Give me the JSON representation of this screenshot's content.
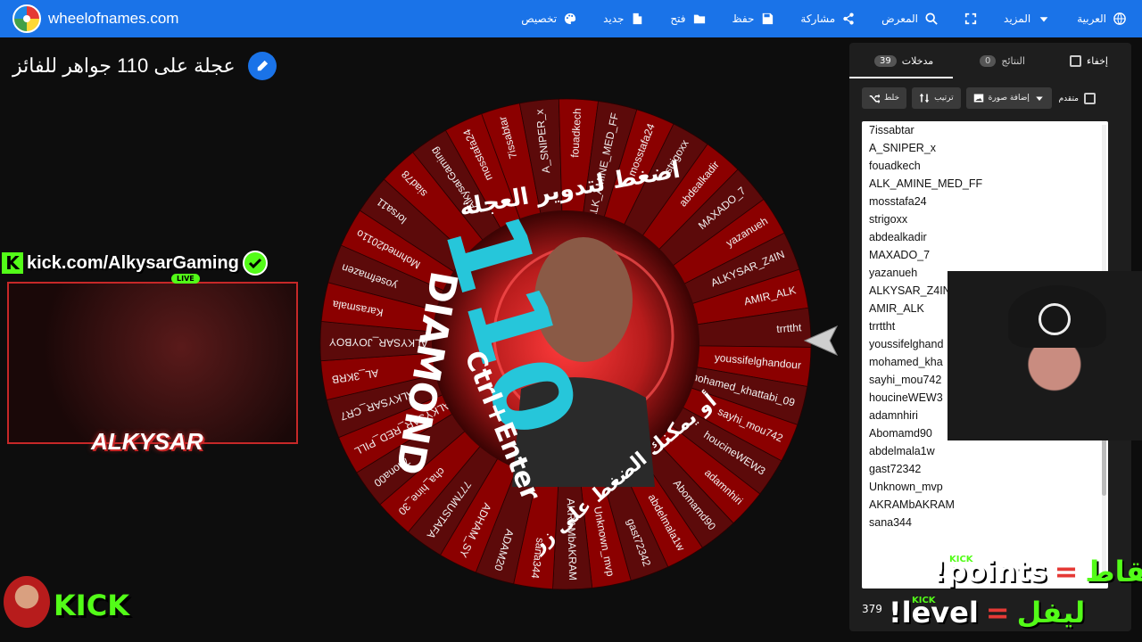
{
  "brand": {
    "site": "wheelofnames.com"
  },
  "menu": [
    {
      "label": "العربية",
      "icon": "globe-icon"
    },
    {
      "label": "المزيد",
      "icon": "caret-down-icon"
    },
    {
      "label": "",
      "icon": "fullscreen-icon"
    },
    {
      "label": "المعرض",
      "icon": "search-icon"
    },
    {
      "label": "مشاركة",
      "icon": "share-icon"
    },
    {
      "label": "حفظ",
      "icon": "save-icon"
    },
    {
      "label": "فتح",
      "icon": "folder-icon"
    },
    {
      "label": "جديد",
      "icon": "file-icon"
    },
    {
      "label": "تخصيص",
      "icon": "palette-icon"
    }
  ],
  "title": "عجلة على 110 جواهر للفائز",
  "wheel": {
    "entries": [
      "7issabtar",
      "A_SNIPER_x",
      "fouadkech",
      "ALK_AMINE_MED_FF",
      "mosstafa24",
      "strigoxx",
      "abdealkadir",
      "MAXADO_7",
      "yazanueh",
      "ALKYSAR_Z4IN",
      "AMIR_ALK",
      "trrttht",
      "youssifelghandour",
      "mohamed_khattabi_09",
      "sayhi_mou742",
      "houcineWEW3",
      "adamnhiri",
      "Abomamd90",
      "abdelmala1w",
      "gast72342",
      "Unknown_mvp",
      "AKRAMbAKRAM",
      "sana344",
      "ADAM20",
      "ADHAM_SY",
      "777MUSTAFA",
      "cha_hine_30",
      "7nona00",
      "ALKYSAR_RED_PILL",
      "ALKYSAR_CR7",
      "AL_3KRB",
      "ALKYSAR_JOYBOY",
      "Karasmala",
      "yosefmazen",
      "Mohmed2011o",
      "lorsa11",
      "siad78",
      "AlkysarGaming",
      "mosstafa24"
    ],
    "prompt_top": "اضغط لتدوير العجلة",
    "prompt_bottom": "أو يمكنك الضغط على زر",
    "shortcut": "Ctrl+Enter",
    "center_number": "110",
    "center_word": "DIAMOND",
    "colors": {
      "slice_a": "#8b0000",
      "slice_b": "#5c0a0a",
      "accent": "#26c6da"
    }
  },
  "panel": {
    "tab_entries": "مدخلات",
    "tab_entries_count": "39",
    "tab_results": "النتائج",
    "tab_results_count": "0",
    "hide_label": "إخفاء",
    "shuffle_label": "خلط",
    "sort_label": "ترتيب",
    "add_image_label": "إضافة صورة",
    "advanced_label": "متقدم",
    "entries": [
      "7issabtar",
      "A_SNIPER_x",
      "fouadkech",
      "ALK_AMINE_MED_FF",
      "mosstafa24",
      "strigoxx",
      "abdealkadir",
      "MAXADO_7",
      "yazanueh",
      "ALKYSAR_Z4IN",
      "AMIR_ALK",
      "trrttht",
      "youssifelghand",
      "mohamed_kha",
      "sayhi_mou742",
      "houcineWEW3",
      "adamnhiri",
      "Abomamd90",
      "abdelmala1w",
      "gast72342",
      "Unknown_mvp",
      "AKRAMbAKRAM",
      "sana344"
    ],
    "count": "379"
  },
  "overlay": {
    "kick_url": "kick.com/AlkysarGaming",
    "live": "LIVE",
    "streamer": "ALKYSAR",
    "kick_logo": "KICK",
    "promo_points_ar": "نقاط",
    "promo_points_cmd": "!points",
    "promo_level_ar": "ليفل",
    "promo_level_cmd": "!level",
    "kick_tag": "KICK"
  }
}
